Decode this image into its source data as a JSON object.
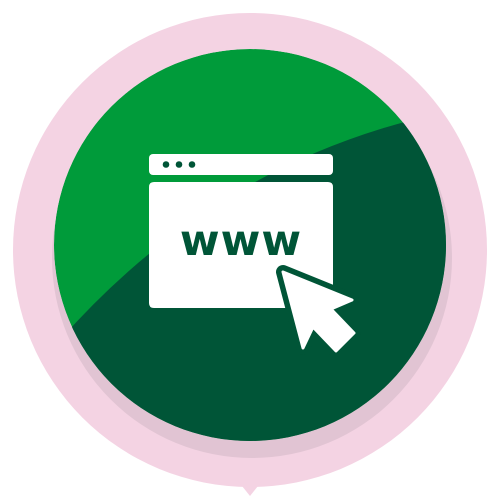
{
  "icon": {
    "semantic": "website-click-icon",
    "url_text": "www",
    "colors": {
      "outer_ring": "#f4d3e3",
      "shadow": "#e1c4d3",
      "light_green": "#009b3a",
      "dark_green": "#005537",
      "white": "#ffffff"
    }
  }
}
